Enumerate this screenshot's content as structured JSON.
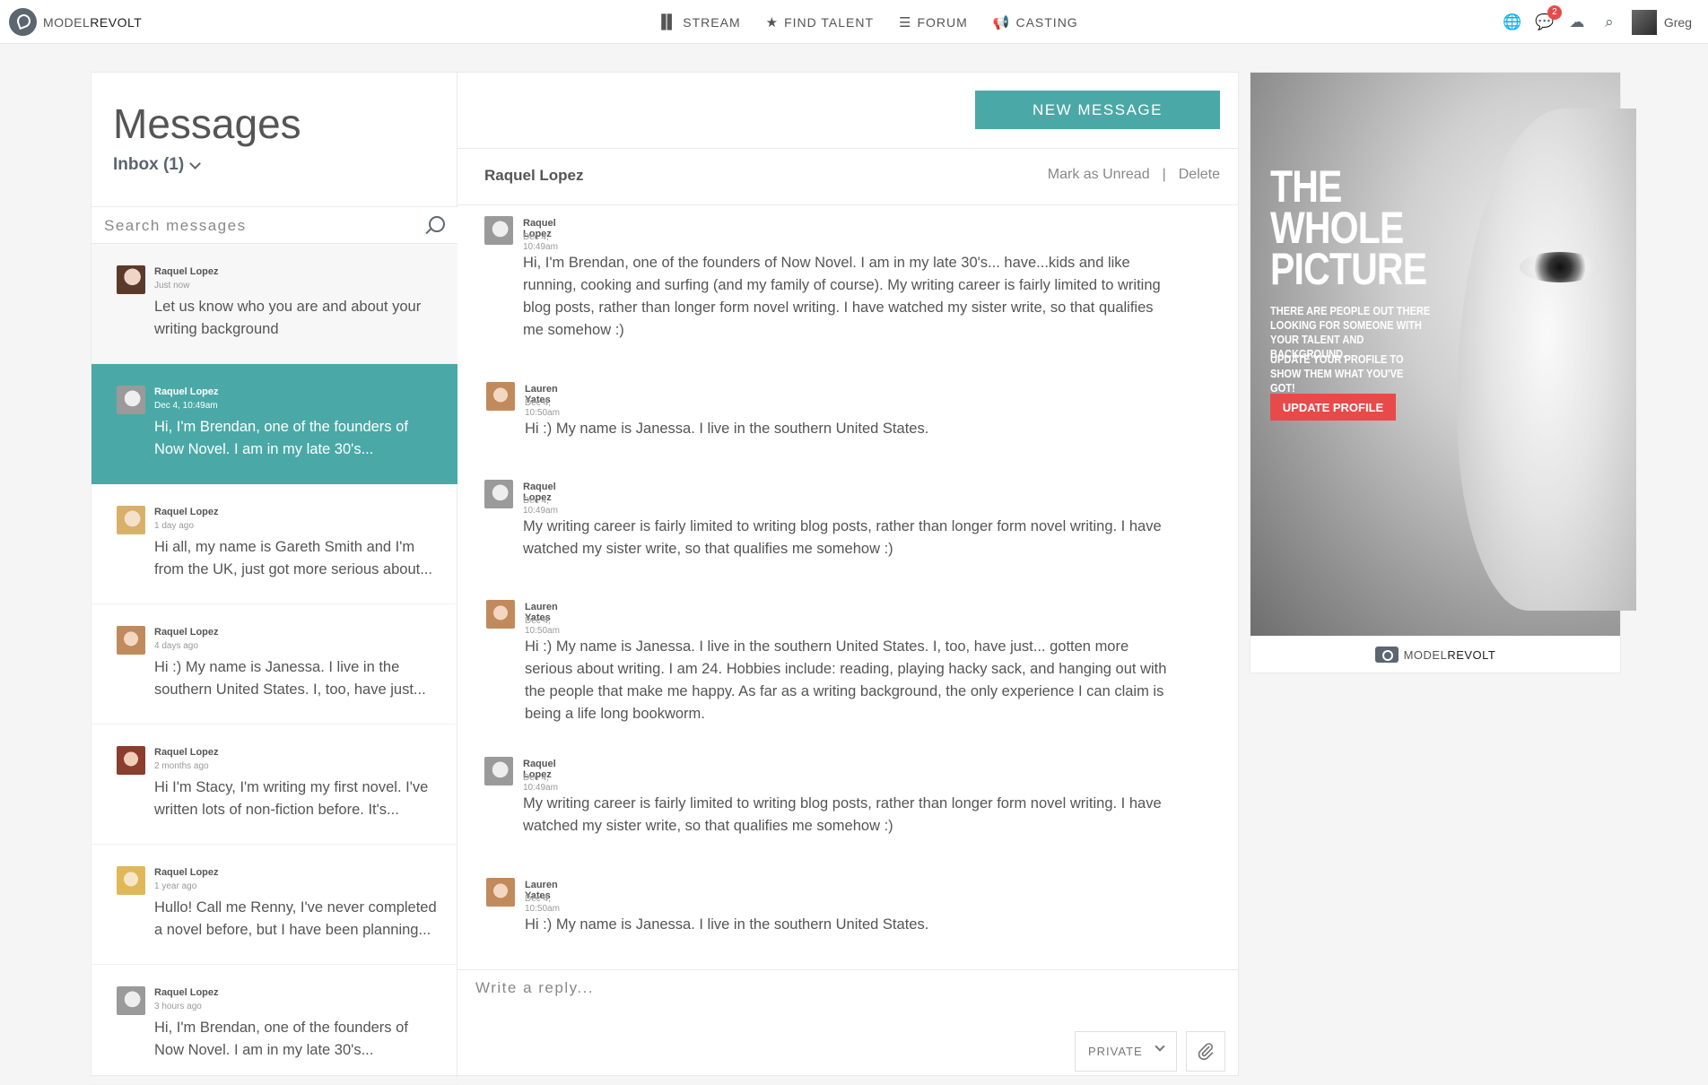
{
  "topbar": {
    "logo_text_light": "MODEL",
    "logo_text_bold": "REVOLT",
    "nav": [
      {
        "label": "STREAM",
        "icon": "stream-icon"
      },
      {
        "label": "FIND TALENT",
        "icon": "star-icon"
      },
      {
        "label": "FORUM",
        "icon": "forum-icon"
      },
      {
        "label": "CASTING",
        "icon": "megaphone-icon"
      }
    ],
    "notification_count": "2",
    "user_name": "Greg"
  },
  "sidebar": {
    "title": "Messages",
    "inbox_label": "Inbox (1)",
    "search_placeholder": "Search messages",
    "conversations": [
      {
        "name": "Raquel Lopez",
        "time": "Just now",
        "text": "Let us know who you are and about your writing background"
      },
      {
        "name": "Raquel Lopez",
        "time": "Dec 4, 10:49am",
        "text": "Hi, I'm Brendan, one of the founders of Now Novel. I am in my late 30's..."
      },
      {
        "name": "Raquel Lopez",
        "time": "1 day ago",
        "text": "Hi all, my name is Gareth Smith and I'm from the UK, just got more serious about..."
      },
      {
        "name": "Raquel Lopez",
        "time": "4 days ago",
        "text": "Hi :) My name is Janessa. I live in the southern United States. I, too, have just..."
      },
      {
        "name": "Raquel Lopez",
        "time": "2 months ago",
        "text": "Hi I'm Stacy, I'm writing my first novel. I've written lots of non-fiction before. It's..."
      },
      {
        "name": "Raquel Lopez",
        "time": "1 year ago",
        "text": "Hullo! Call me Renny, I've never completed a novel before, but I have been planning..."
      },
      {
        "name": "Raquel Lopez",
        "time": "3 hours ago",
        "text": "Hi, I'm Brendan, one of the founders of Now Novel. I am in my late 30's..."
      }
    ]
  },
  "thread": {
    "new_message_label": "NEW MESSAGE",
    "contact_name": "Raquel Lopez",
    "mark_unread_label": "Mark as Unread",
    "separator": "|",
    "delete_label": "Delete",
    "messages": [
      {
        "name": "Raquel Lopez",
        "time": "Dec 4, 10:49am",
        "text": "Hi, I'm Brendan, one of the founders of Now Novel. I am in my late 30's... have...kids and like running, cooking and surfing (and my family of course). My writing career is fairly limited to writing blog posts, rather than longer form novel writing. I have watched my sister write, so that qualifies me somehow :)"
      },
      {
        "name": "Lauren Yates",
        "time": "Dec 4, 10:50am",
        "text": "Hi :) My name is Janessa. I live in the southern United States."
      },
      {
        "name": "Raquel Lopez",
        "time": "Dec 4, 10:49am",
        "text": "My writing career is fairly limited to writing blog posts, rather than longer form novel writing. I have watched my sister write, so that qualifies me somehow :)"
      },
      {
        "name": "Lauren Yates",
        "time": "Dec 4, 10:50am",
        "text": "Hi :) My name is Janessa. I live in the southern United States. I, too, have just... gotten more serious about writing. I am 24. Hobbies include: reading, playing hacky sack, and hanging out with the people that make me happy. As far as a writing background, the only experience I can claim is being a life long bookworm."
      },
      {
        "name": "Raquel Lopez",
        "time": "Dec 4, 10:49am",
        "text": "My writing career is fairly limited to writing blog posts, rather than longer form novel writing. I have watched my sister write, so that qualifies me somehow :)"
      },
      {
        "name": "Lauren Yates",
        "time": "Dec 4, 10:50am",
        "text": "Hi :) My name is Janessa. I live in the southern United States."
      }
    ],
    "reply_placeholder": "Write a reply...",
    "privacy_label": "PRIVATE"
  },
  "ad": {
    "title_line1": "THE",
    "title_line2": "WHOLE",
    "title_line3": "PICTURE",
    "subtitle1": "THERE ARE PEOPLE OUT THERE LOOKING FOR SOMEONE WITH YOUR TALENT AND BACKGROUND.",
    "subtitle2": "UPDATE YOUR PROFILE TO SHOW THEM WHAT YOU'VE GOT!",
    "button_label": "UPDATE PROFILE",
    "footer_light": "MODEL",
    "footer_bold": "REVOLT"
  },
  "colors": {
    "accent": "#4aa9a6",
    "badge": "#e84a4a",
    "ad_button": "#e84a4a"
  }
}
